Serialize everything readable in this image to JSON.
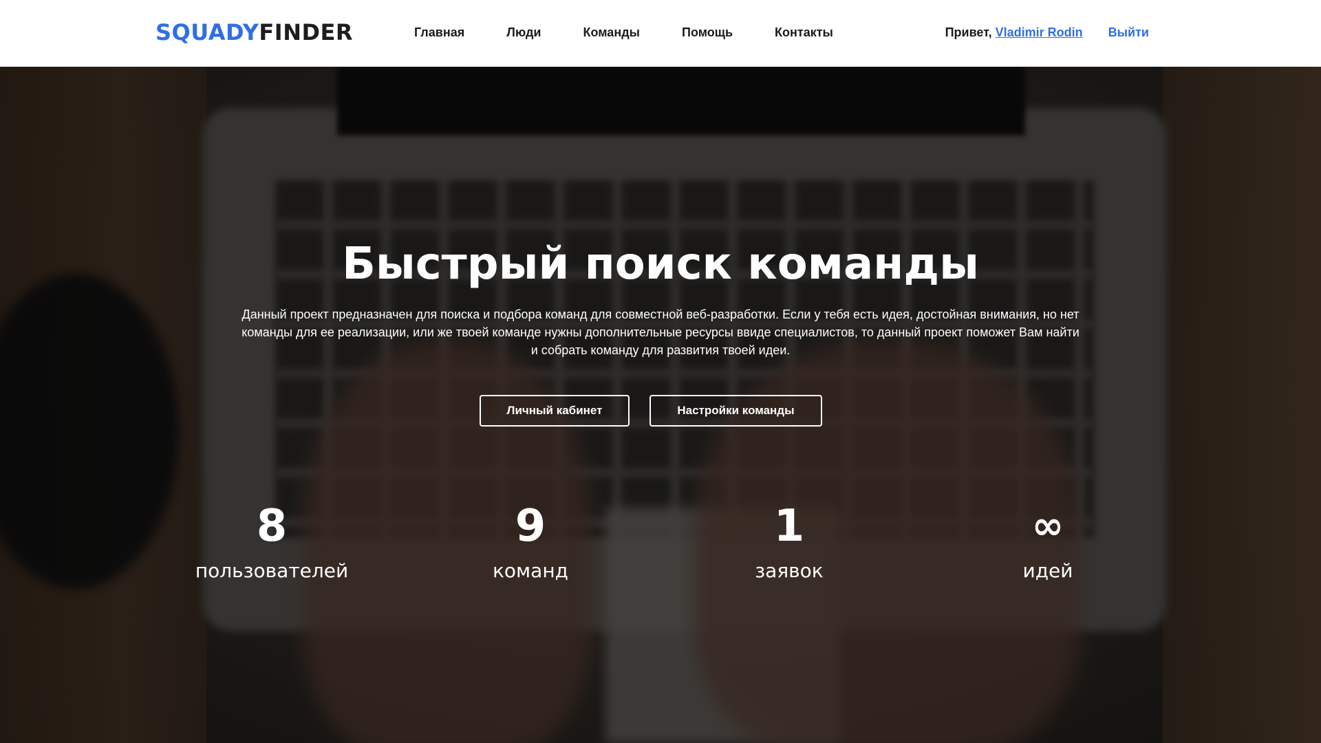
{
  "header": {
    "logo_part1": "SQUADY",
    "logo_part2": "FINDER",
    "nav": [
      "Главная",
      "Люди",
      "Команды",
      "Помощь",
      "Контакты"
    ],
    "greeting": "Привет,",
    "user_name": "Vladimir Rodin",
    "logout": "Выйти"
  },
  "hero": {
    "title": "Быстрый поиск команды",
    "description": "Данный проект предназначен для поиска и подбора команд для совместной веб-разработки. Если у тебя есть идея, достойная внимания, но нет команды для ее реализации, или же твоей команде нужны дополнительные ресурсы ввиде специалистов, то данный проект поможет Вам найти и собрать команду для развития твоей идеи.",
    "buttons": {
      "cabinet": "Личный кабинет",
      "team_settings": "Настройки команды"
    }
  },
  "stats": [
    {
      "value": "8",
      "label": "пользователей"
    },
    {
      "value": "9",
      "label": "команд"
    },
    {
      "value": "1",
      "label": "заявок"
    },
    {
      "value": "∞",
      "label": "идей"
    }
  ],
  "colors": {
    "accent": "#2f6fe4",
    "header_bg": "#ffffff",
    "text_dark": "#1a1a1a",
    "hero_text": "#ffffff"
  }
}
